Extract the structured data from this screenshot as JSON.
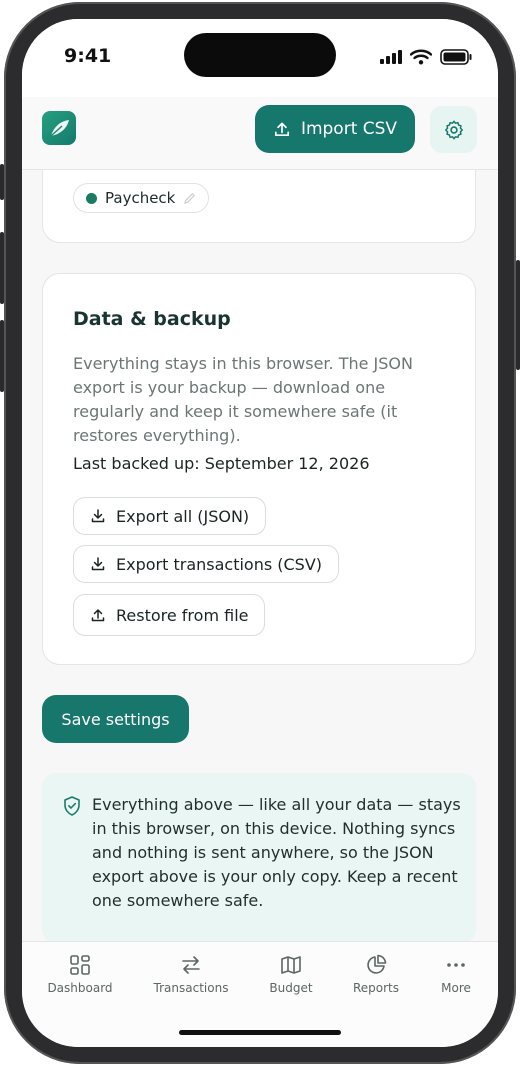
{
  "status": {
    "time": "9:41"
  },
  "header": {
    "import_label": "Import CSV"
  },
  "categories": {
    "chip_label": "Paycheck"
  },
  "backup": {
    "title": "Data & backup",
    "description": "Everything stays in this browser. The JSON export is your backup — download one regularly and keep it somewhere safe (it restores everything).",
    "last_backed_up": "Last backed up: September 12, 2026",
    "export_json": "Export all (JSON)",
    "export_csv": "Export transactions (CSV)",
    "restore": "Restore from file"
  },
  "save_label": "Save settings",
  "notice": "Everything above — like all your data — stays in this browser, on this device. Nothing syncs and nothing is sent anywhere, so the JSON export above is your only copy. Keep a recent one somewhere safe.",
  "tabs": [
    "Dashboard",
    "Transactions",
    "Budget",
    "Reports",
    "More"
  ],
  "colors": {
    "accent": "#16776c",
    "notice_bg": "#e9f6f4"
  }
}
